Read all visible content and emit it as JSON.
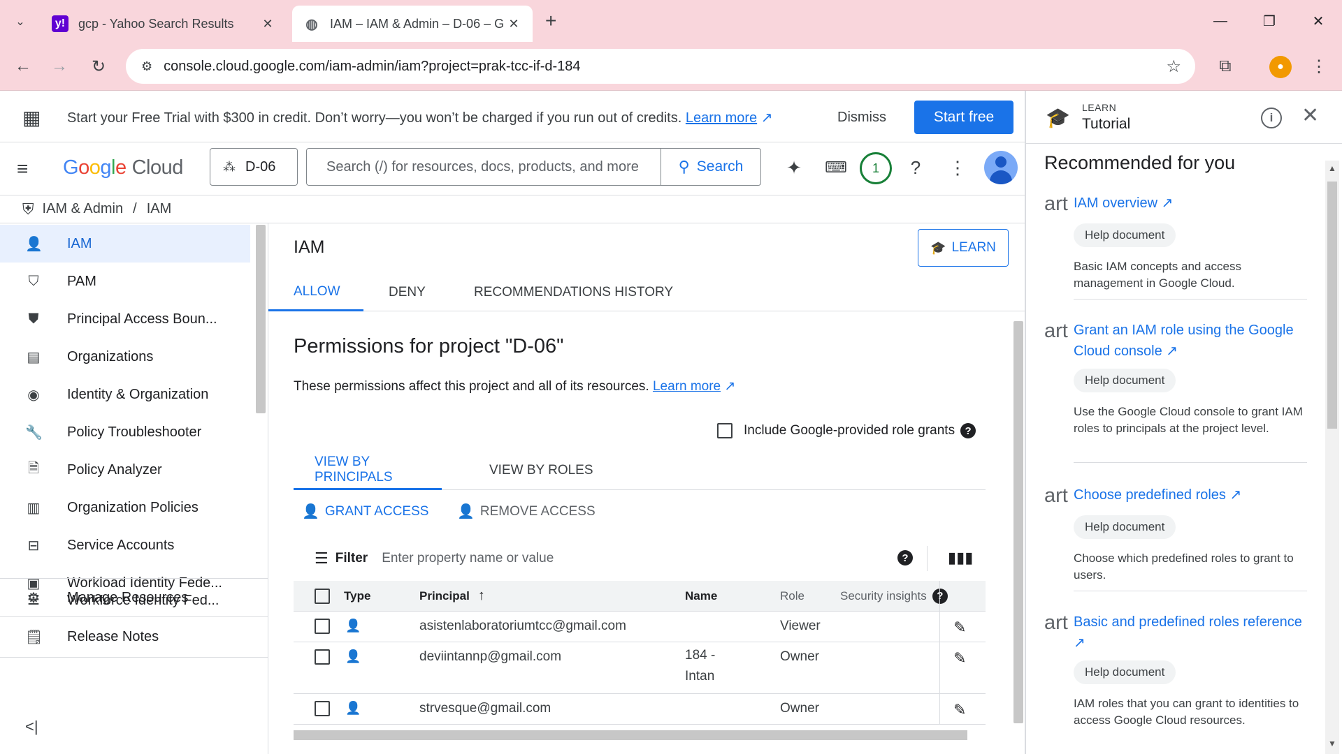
{
  "browser": {
    "tabs": [
      {
        "title": "gcp - Yahoo Search Results",
        "favicon": "yahoo-icon"
      },
      {
        "title": "IAM – IAM & Admin – D-06 – G",
        "favicon": "globe-icon"
      }
    ],
    "url": "console.cloud.google.com/iam-admin/iam?project=prak-tcc-if-d-184"
  },
  "banner": {
    "text": "Start your Free Trial with $300 in credit. Don’t worry—you won’t be charged if you run out of credits.",
    "learn_more": "Learn more",
    "dismiss": "Dismiss",
    "start_free": "Start free"
  },
  "header": {
    "logo_google": [
      "G",
      "o",
      "o",
      "g",
      "l",
      "e"
    ],
    "logo_cloud": "Cloud",
    "project": "D-06",
    "search_placeholder": "Search (/) for resources, docs, products, and more",
    "search_button": "Search",
    "notifications": "1"
  },
  "breadcrumb": {
    "section": "IAM & Admin",
    "separator": "/",
    "page": "IAM"
  },
  "sidebar": {
    "items": [
      {
        "label": "IAM",
        "icon": "person-add-icon"
      },
      {
        "label": "PAM",
        "icon": "shield-icon"
      },
      {
        "label": "Principal Access Boun...",
        "icon": "policy-shield-icon"
      },
      {
        "label": "Organizations",
        "icon": "building-icon"
      },
      {
        "label": "Identity & Organization",
        "icon": "account-circle-icon"
      },
      {
        "label": "Policy Troubleshooter",
        "icon": "wrench-icon"
      },
      {
        "label": "Policy Analyzer",
        "icon": "document-search-icon"
      },
      {
        "label": "Organization Policies",
        "icon": "list-document-icon"
      },
      {
        "label": "Service Accounts",
        "icon": "service-account-icon"
      },
      {
        "label": "Workload Identity Fede...",
        "icon": "id-card-icon"
      },
      {
        "label": "Workforce Identity Fed...",
        "icon": "workforce-icon"
      }
    ],
    "bottom": [
      {
        "label": "Manage Resources",
        "icon": "settings-folder-icon"
      },
      {
        "label": "Release Notes",
        "icon": "notes-icon"
      }
    ]
  },
  "content": {
    "title": "IAM",
    "learn_button": "LEARN",
    "tabs": [
      "ALLOW",
      "DENY",
      "RECOMMENDATIONS HISTORY"
    ],
    "perm_title": "Permissions for project \"D-06\"",
    "perm_desc": "These permissions affect this project and all of its resources.",
    "perm_learn": "Learn more",
    "include_label": "Include Google-provided role grants",
    "view_tabs": [
      "VIEW BY PRINCIPALS",
      "VIEW BY ROLES"
    ],
    "grant_access": "GRANT ACCESS",
    "remove_access": "REMOVE ACCESS",
    "filter_label": "Filter",
    "filter_placeholder": "Enter property name or value",
    "columns": {
      "type": "Type",
      "principal": "Principal",
      "name": "Name",
      "role": "Role",
      "insights": "Security insights"
    },
    "rows": [
      {
        "principal": "asistenlaboratoriumtcc@gmail.com",
        "name": "",
        "name2": "",
        "role": "Viewer"
      },
      {
        "principal": "deviintannp@gmail.com",
        "name": "184 -",
        "name2": "Intan",
        "role": "Owner"
      },
      {
        "principal": "strvesque@gmail.com",
        "name": "",
        "name2": "",
        "role": "Owner"
      }
    ]
  },
  "panel": {
    "eyebrow": "LEARN",
    "title": "Tutorial",
    "rec_title": "Recommended for you",
    "items": [
      {
        "art": "art",
        "link": "IAM overview",
        "chip": "Help document",
        "desc": "Basic IAM concepts and access management in Google Cloud."
      },
      {
        "art": "art",
        "link": "Grant an IAM role using the Google Cloud console",
        "chip": "Help document",
        "desc": "Use the Google Cloud console to grant IAM roles to principals at the project level."
      },
      {
        "art": "art",
        "link": "Choose predefined roles",
        "chip": "Help document",
        "desc": "Choose which predefined roles to grant to users."
      },
      {
        "art": "art",
        "link": "Basic and predefined roles reference",
        "chip": "Help document",
        "desc": "IAM roles that you can grant to identities to access Google Cloud resources."
      }
    ]
  },
  "colors": {
    "accent": "#1a73e8",
    "tabbar": "#f9d6dc",
    "active_nav": "#e8f0fe"
  }
}
